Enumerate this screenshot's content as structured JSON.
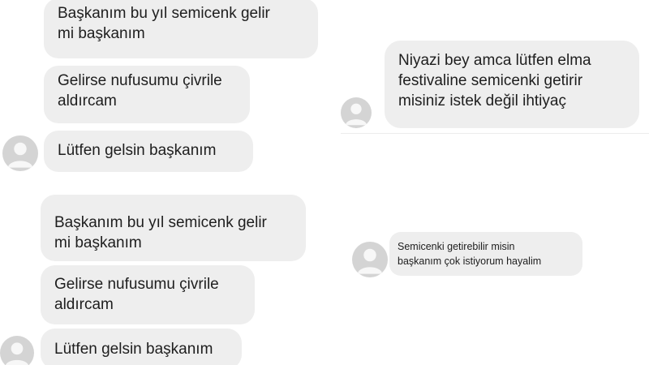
{
  "panels": [
    {
      "messages": [
        "Başkanım bu yıl semicenk gelir\nmi başkanım",
        "Gelirse nufusumu çivrile\naldırcam",
        "Lütfen gelsin başkanım"
      ],
      "avatar_icon": "user-avatar-icon"
    },
    {
      "messages": [
        "Niyazi bey amca lütfen elma\nfestivaline semicenki getirir\nmisiniz istek değil ihtiyaç"
      ],
      "avatar_icon": "user-avatar-icon"
    },
    {
      "messages": [
        "Başkanım bu yıl semicenk gelir\nmi başkanım",
        "Gelirse nufusumu çivrile\naldırcam",
        "Lütfen gelsin başkanım"
      ],
      "avatar_icon": "user-avatar-icon"
    },
    {
      "messages": [
        "Semicenki getirebilir misin\nbaşkanım çok istiyorum hayalim"
      ],
      "avatar_icon": "user-avatar-icon"
    }
  ],
  "colors": {
    "bubble_bg": "#eeeeee",
    "text": "#1e1e1e",
    "avatar_bg": "#d4d4d4",
    "avatar_fg": "#f7f7f7"
  }
}
